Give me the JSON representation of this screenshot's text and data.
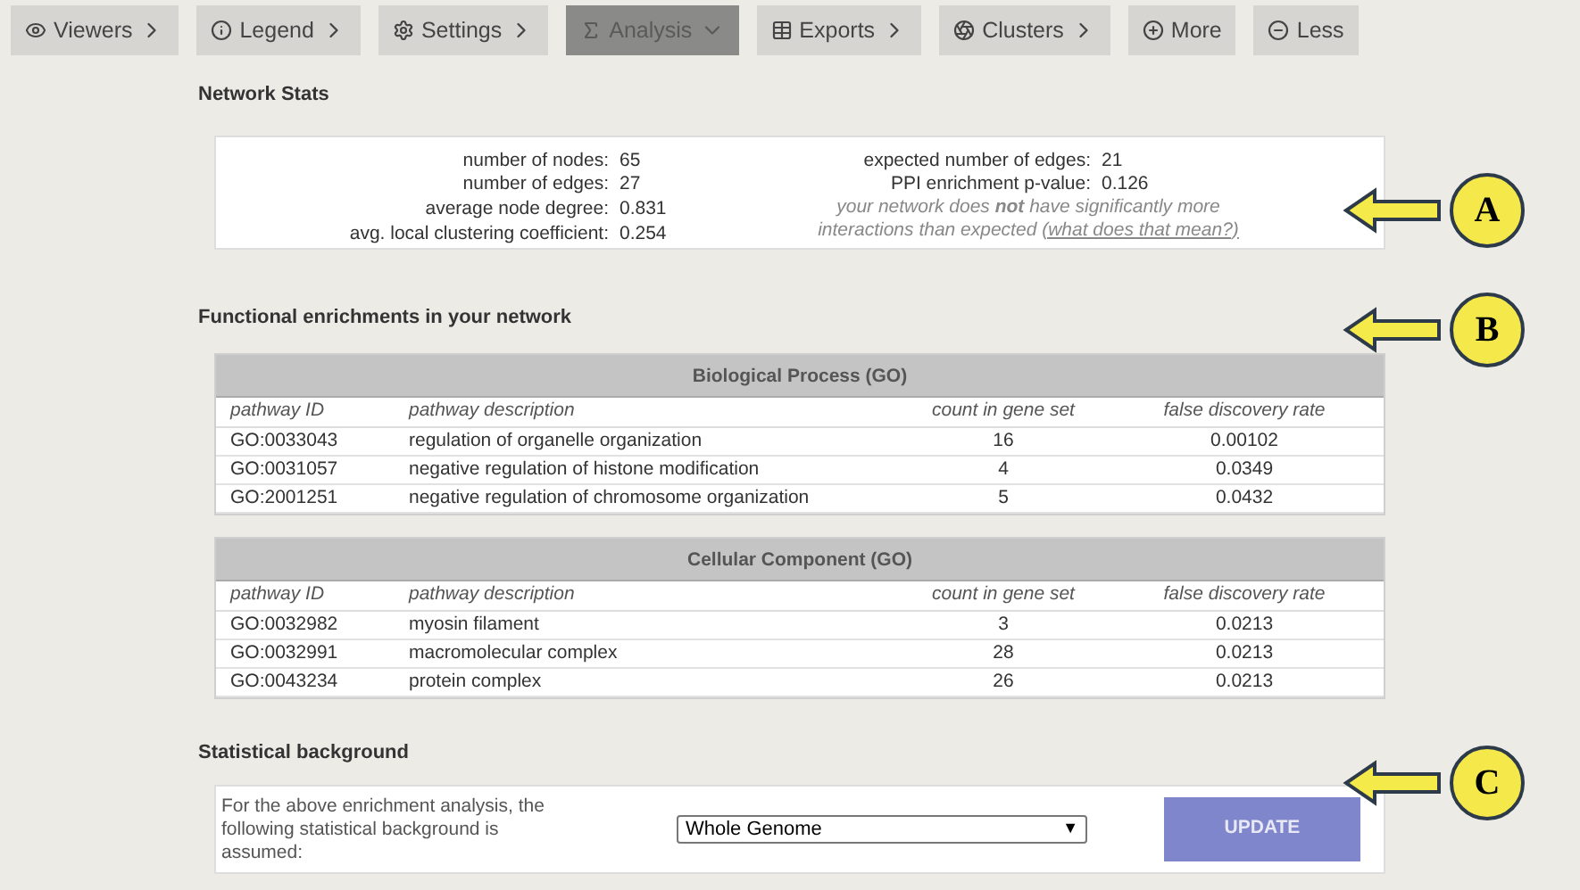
{
  "toolbar": [
    {
      "label": "Viewers",
      "kind": "menu",
      "selected": false
    },
    {
      "label": "Legend",
      "kind": "menu",
      "selected": false
    },
    {
      "label": "Settings",
      "kind": "menu",
      "selected": false
    },
    {
      "label": "Analysis",
      "kind": "menu",
      "selected": true
    },
    {
      "label": "Exports",
      "kind": "menu",
      "selected": false
    },
    {
      "label": "Clusters",
      "kind": "menu",
      "selected": false
    },
    {
      "label": "More",
      "kind": "action",
      "selected": false
    },
    {
      "label": "Less",
      "kind": "action",
      "selected": false
    }
  ],
  "network_stats": {
    "title": "Network Stats",
    "left": [
      {
        "label": "number of nodes:",
        "value": "65"
      },
      {
        "label": "number of edges:",
        "value": "27"
      },
      {
        "label": "average node degree:",
        "value": "0.831"
      },
      {
        "label": "avg. local clustering coefficient:",
        "value": "0.254"
      }
    ],
    "right": [
      {
        "label": "expected number of edges:",
        "value": "21"
      },
      {
        "label": "PPI enrichment p-value:",
        "value": "0.126"
      }
    ],
    "note": "your network does **not** have significantly more interactions than expected",
    "note_link": "(what does that mean?)"
  },
  "enrichments": {
    "title": "Functional enrichments in your network",
    "tables": [
      {
        "title": "Biological Process (GO)",
        "columns": [
          "pathway ID",
          "pathway description",
          "count in gene set",
          "false discovery rate"
        ],
        "rows": [
          [
            "GO:0033043",
            "regulation of organelle organization",
            "16",
            "0.00102"
          ],
          [
            "GO:0031057",
            "negative regulation of histone modification",
            "4",
            "0.0349"
          ],
          [
            "GO:2001251",
            "negative regulation of chromosome organization",
            "5",
            "0.0432"
          ]
        ]
      },
      {
        "title": "Cellular Component (GO)",
        "columns": [
          "pathway ID",
          "pathway description",
          "count in gene set",
          "false discovery rate"
        ],
        "rows": [
          [
            "GO:0032982",
            "myosin filament",
            "3",
            "0.0213"
          ],
          [
            "GO:0032991",
            "macromolecular complex",
            "28",
            "0.0213"
          ],
          [
            "GO:0043234",
            "protein complex",
            "26",
            "0.0213"
          ]
        ]
      }
    ]
  },
  "background": {
    "title": "Statistical background",
    "text": "For the above enrichment analysis, the following statistical background is assumed:",
    "select_value": "Whole Genome",
    "select_arrow": "▼",
    "button": "UPDATE"
  },
  "callouts": [
    {
      "letter": "A"
    },
    {
      "letter": "B"
    },
    {
      "letter": "C"
    }
  ]
}
